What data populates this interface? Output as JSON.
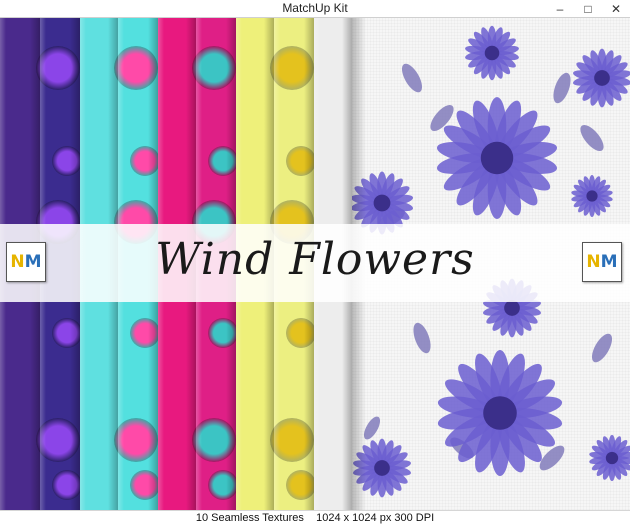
{
  "window": {
    "title": "MatchUp Kit",
    "minimize_glyph": "–",
    "maximize_glyph": "□",
    "close_glyph": "✕"
  },
  "colors": {
    "strips": [
      "#4a2a8c",
      "#3b2c8f",
      "#5fe0e0",
      "#53e0df",
      "#e8197f",
      "#df1f86",
      "#eef07a",
      "#ecef81",
      "#ededed",
      "#e9e9e9"
    ],
    "flowers": [
      "none",
      "#8b45e8",
      "none",
      "#ff4aa8",
      "none",
      "#3cc4c4",
      "none",
      "#e4c21e",
      "none",
      "none"
    ],
    "big_flower": "#6b5ed0",
    "big_leaf": "#7a74b8"
  },
  "banner": {
    "title": "Wind Flowers",
    "logo_left": {
      "n": "N",
      "m": "M"
    },
    "logo_right": {
      "n": "N",
      "m": "M"
    }
  },
  "status": {
    "text": "10 Seamless Textures    1024 x 1024 px 300 DPI"
  }
}
